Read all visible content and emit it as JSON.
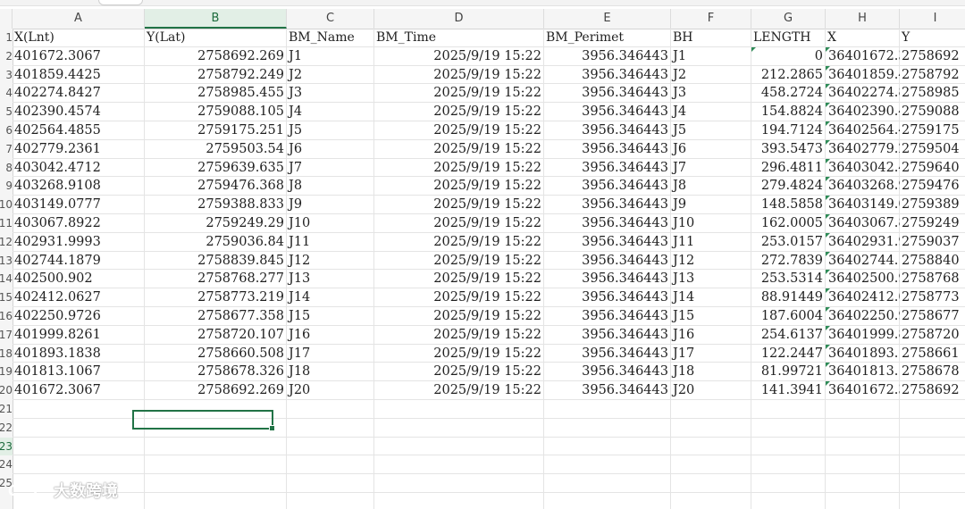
{
  "columns": [
    "A",
    "B",
    "C",
    "D",
    "E",
    "F",
    "G",
    "H",
    "I"
  ],
  "selected_column": "B",
  "row_numbers": [
    "1",
    "2",
    "3",
    "4",
    "5",
    "6",
    "7",
    "8",
    "9",
    "10",
    "11",
    "12",
    "13",
    "14",
    "15",
    "16",
    "17",
    "18",
    "19",
    "20",
    "21",
    "22",
    "23",
    "24",
    "25"
  ],
  "selected_row": "23",
  "header_row": [
    "X(Lnt)",
    "Y(Lat)",
    "BM_Name",
    "BM_Time",
    "BM_Perimet",
    "BH",
    "LENGTH",
    "X",
    "Y"
  ],
  "rows": [
    [
      "401672.3067",
      "2758692.269",
      "J1",
      "2025/9/19  15:22",
      "3956.346443",
      "J1",
      "0",
      "36401672.3",
      "2758692"
    ],
    [
      "401859.4425",
      "2758792.249",
      "J2",
      "2025/9/19  15:22",
      "3956.346443",
      "J2",
      "212.2865",
      "36401859.4",
      "2758792"
    ],
    [
      "402274.8427",
      "2758985.455",
      "J3",
      "2025/9/19  15:22",
      "3956.346443",
      "J3",
      "458.2724",
      "36402274.8",
      "2758985"
    ],
    [
      "402390.4574",
      "2759088.105",
      "J4",
      "2025/9/19  15:22",
      "3956.346443",
      "J4",
      "154.8824",
      "36402390.4",
      "2759088"
    ],
    [
      "402564.4855",
      "2759175.251",
      "J5",
      "2025/9/19  15:22",
      "3956.346443",
      "J5",
      "194.7124",
      "36402564.4",
      "2759175"
    ],
    [
      "402779.2361",
      "2759503.54",
      "J6",
      "2025/9/19  15:22",
      "3956.346443",
      "J6",
      "393.5473",
      "36402779.2",
      "2759504"
    ],
    [
      "403042.4712",
      "2759639.635",
      "J7",
      "2025/9/19  15:22",
      "3956.346443",
      "J7",
      "296.4811",
      "36403042.4",
      "2759640"
    ],
    [
      "403268.9108",
      "2759476.368",
      "J8",
      "2025/9/19  15:22",
      "3956.346443",
      "J8",
      "279.4824",
      "36403268.9",
      "2759476"
    ],
    [
      "403149.0777",
      "2759388.833",
      "J9",
      "2025/9/19  15:22",
      "3956.346443",
      "J9",
      "148.5858",
      "36403149.0",
      "2759389"
    ],
    [
      "403067.8922",
      "2759249.29",
      "J10",
      "2025/9/19  15:22",
      "3956.346443",
      "J10",
      "162.0005",
      "36403067.8",
      "2759249"
    ],
    [
      "402931.9993",
      "2759036.84",
      "J11",
      "2025/9/19  15:22",
      "3956.346443",
      "J11",
      "253.0157",
      "36402931.9",
      "2759037"
    ],
    [
      "402744.1879",
      "2758839.845",
      "J12",
      "2025/9/19  15:22",
      "3956.346443",
      "J12",
      "272.7839",
      "36402744.",
      "2758840"
    ],
    [
      "402500.902",
      "2758768.277",
      "J13",
      "2025/9/19  15:22",
      "3956.346443",
      "J13",
      "253.5314",
      "36402500.9",
      "2758768"
    ],
    [
      "402412.0627",
      "2758773.219",
      "J14",
      "2025/9/19  15:22",
      "3956.346443",
      "J14",
      "88.91449",
      "36402412.0",
      "2758773"
    ],
    [
      "402250.9726",
      "2758677.358",
      "J15",
      "2025/9/19  15:22",
      "3956.346443",
      "J15",
      "187.6004",
      "36402250.9",
      "2758677"
    ],
    [
      "401999.8261",
      "2758720.107",
      "J16",
      "2025/9/19  15:22",
      "3956.346443",
      "J16",
      "254.6137",
      "36401999.8",
      "2758720"
    ],
    [
      "401893.1838",
      "2758660.508",
      "J17",
      "2025/9/19  15:22",
      "3956.346443",
      "J17",
      "122.2447",
      "36401893.",
      "2758661"
    ],
    [
      "401813.1067",
      "2758678.326",
      "J18",
      "2025/9/19  15:22",
      "3956.346443",
      "J18",
      "81.99721",
      "36401813.",
      "2758678"
    ],
    [
      "401672.3067",
      "2758692.269",
      "J20",
      "2025/9/19  15:22",
      "3956.346443",
      "J20",
      "141.3941",
      "36401672.3",
      "2758692"
    ]
  ],
  "watermark": "大数跨境",
  "watermark_icon": "cloud-logo-icon"
}
